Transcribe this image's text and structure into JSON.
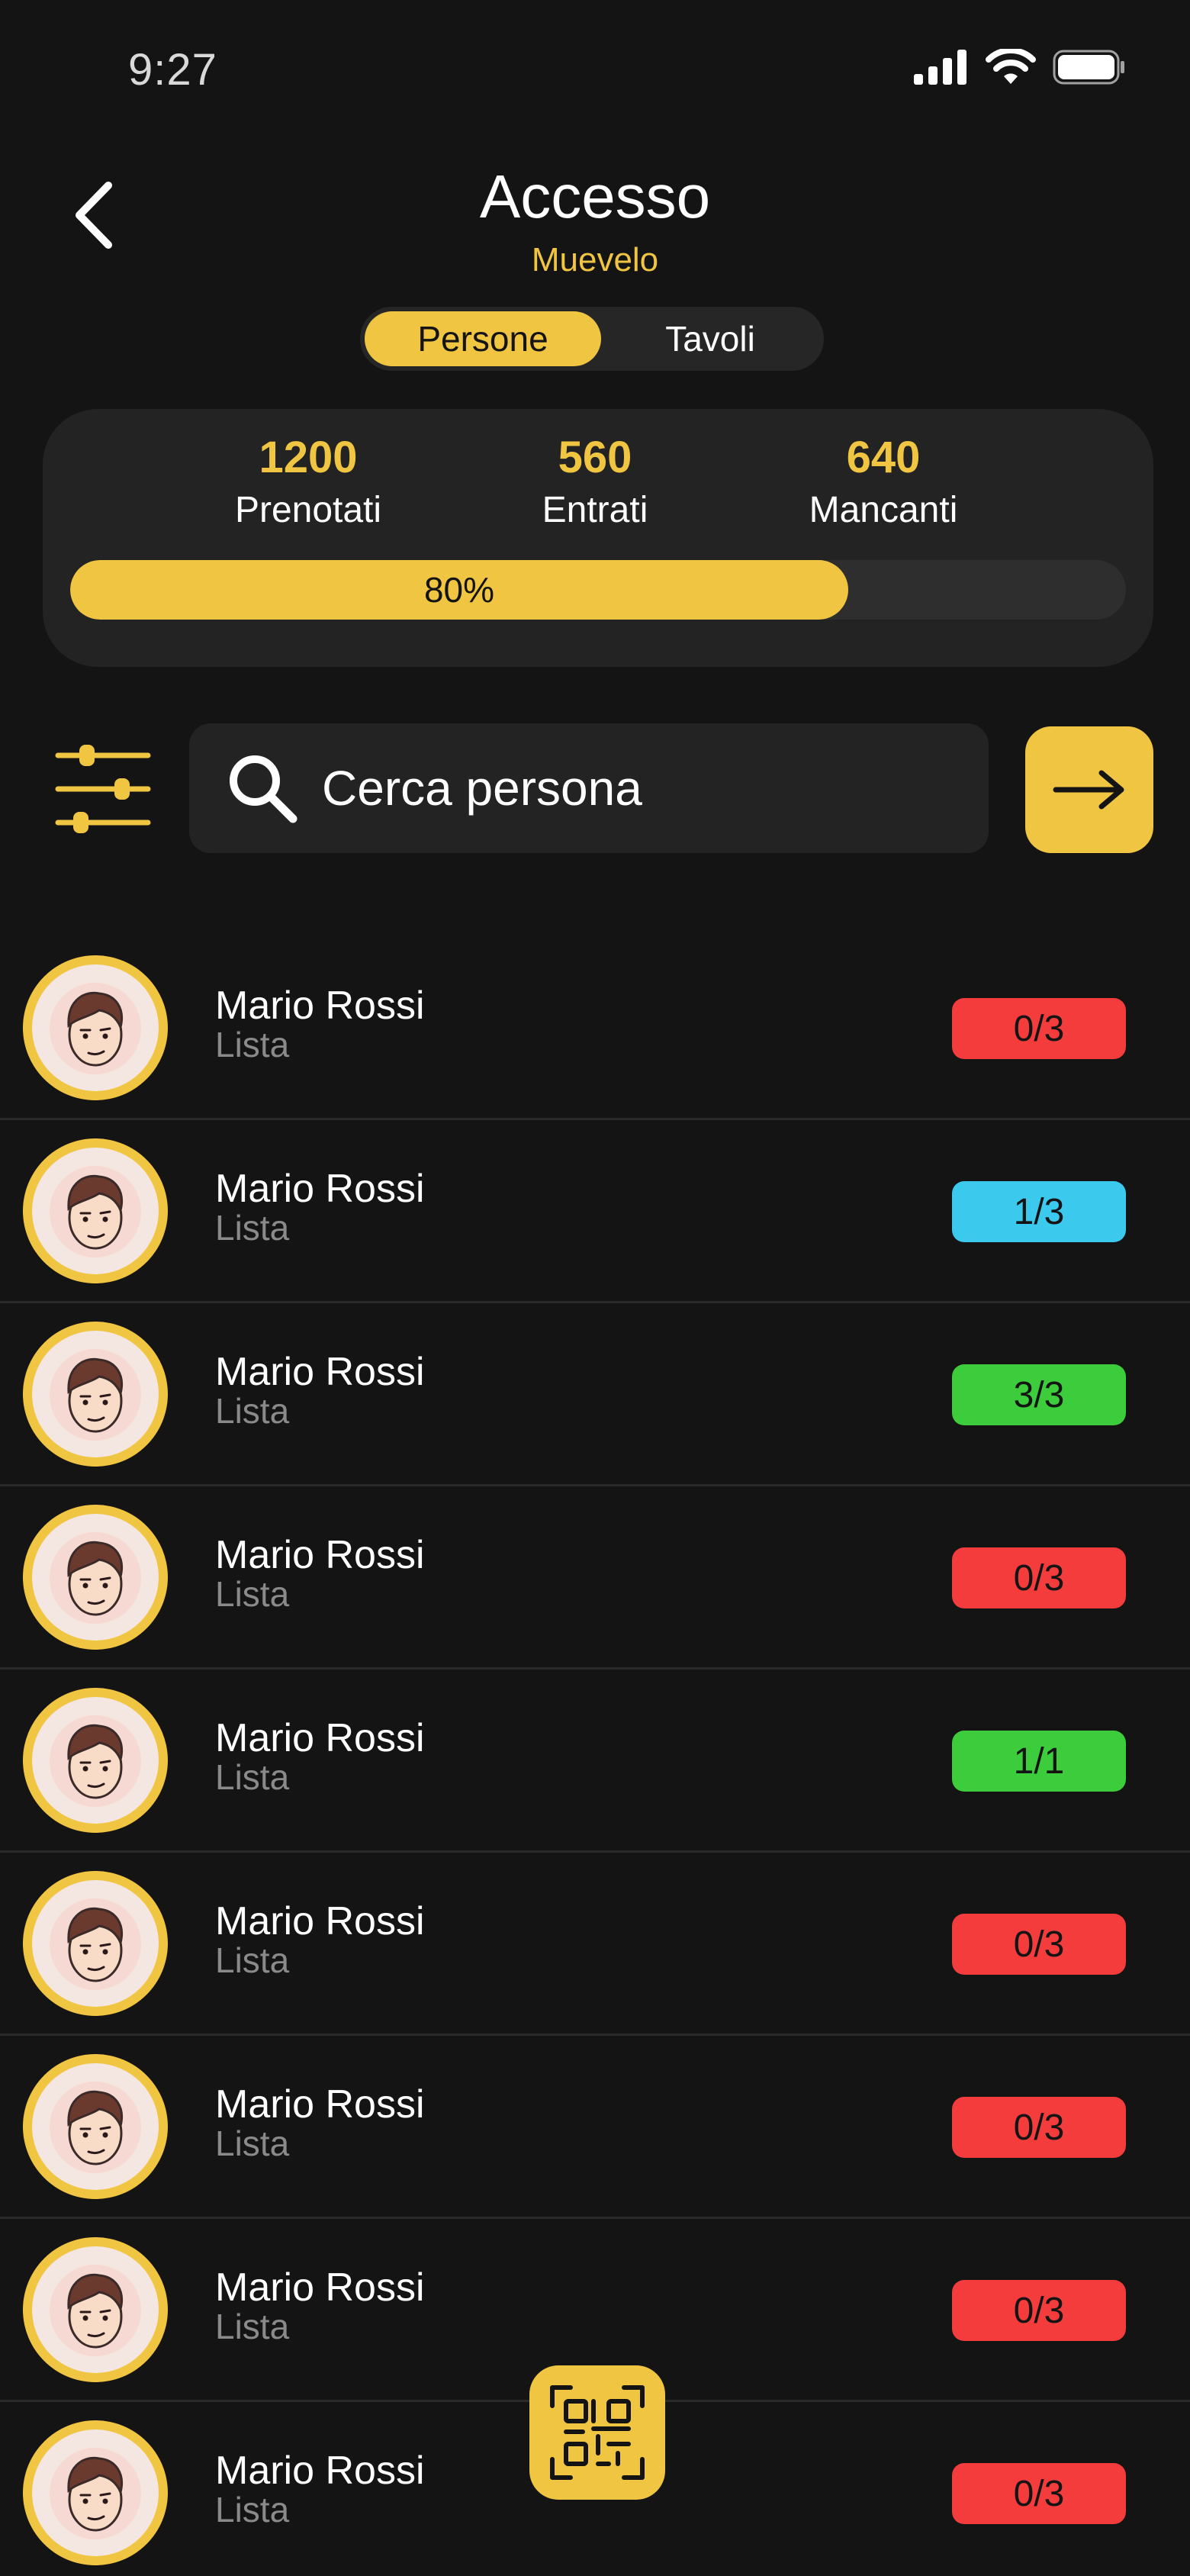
{
  "status_bar": {
    "time": "9:27",
    "icons": [
      "signal-icon",
      "wifi-icon",
      "battery-icon"
    ]
  },
  "header": {
    "back_icon": "chevron-left-icon",
    "title": "Accesso",
    "subtitle": "Muevelo"
  },
  "tabs": [
    {
      "label": "Persone",
      "active": true
    },
    {
      "label": "Tavoli",
      "active": false
    }
  ],
  "stats": {
    "booked": {
      "value": "1200",
      "label": "Prenotati"
    },
    "entered": {
      "value": "560",
      "label": "Entrati"
    },
    "missing": {
      "value": "640",
      "label": "Mancanti"
    },
    "progress": {
      "label": "80%",
      "fraction": 0.737
    }
  },
  "search": {
    "filter_icon": "sliders-icon",
    "search_icon": "search-icon",
    "placeholder": "Cerca persona",
    "value": "",
    "go_icon": "arrow-right-icon"
  },
  "people": [
    {
      "name": "Mario Rossi",
      "sub": "Lista",
      "badge": "0/3",
      "status": "red"
    },
    {
      "name": "Mario Rossi",
      "sub": "Lista",
      "badge": "1/3",
      "status": "blue"
    },
    {
      "name": "Mario Rossi",
      "sub": "Lista",
      "badge": "3/3",
      "status": "green"
    },
    {
      "name": "Mario Rossi",
      "sub": "Lista",
      "badge": "0/3",
      "status": "red"
    },
    {
      "name": "Mario Rossi",
      "sub": "Lista",
      "badge": "1/1",
      "status": "green"
    },
    {
      "name": "Mario Rossi",
      "sub": "Lista",
      "badge": "0/3",
      "status": "red"
    },
    {
      "name": "Mario Rossi",
      "sub": "Lista",
      "badge": "0/3",
      "status": "red"
    },
    {
      "name": "Mario Rossi",
      "sub": "Lista",
      "badge": "0/3",
      "status": "red"
    },
    {
      "name": "Mario Rossi",
      "sub": "Lista",
      "badge": "0/3",
      "status": "red"
    }
  ],
  "qr_button": {
    "icon": "qr-code-icon"
  },
  "colors": {
    "background": "#141414",
    "accent": "#f0c542",
    "red": "#f43c3c",
    "blue": "#3cc9ee",
    "green": "#3ccc3c",
    "card": "#232323"
  }
}
